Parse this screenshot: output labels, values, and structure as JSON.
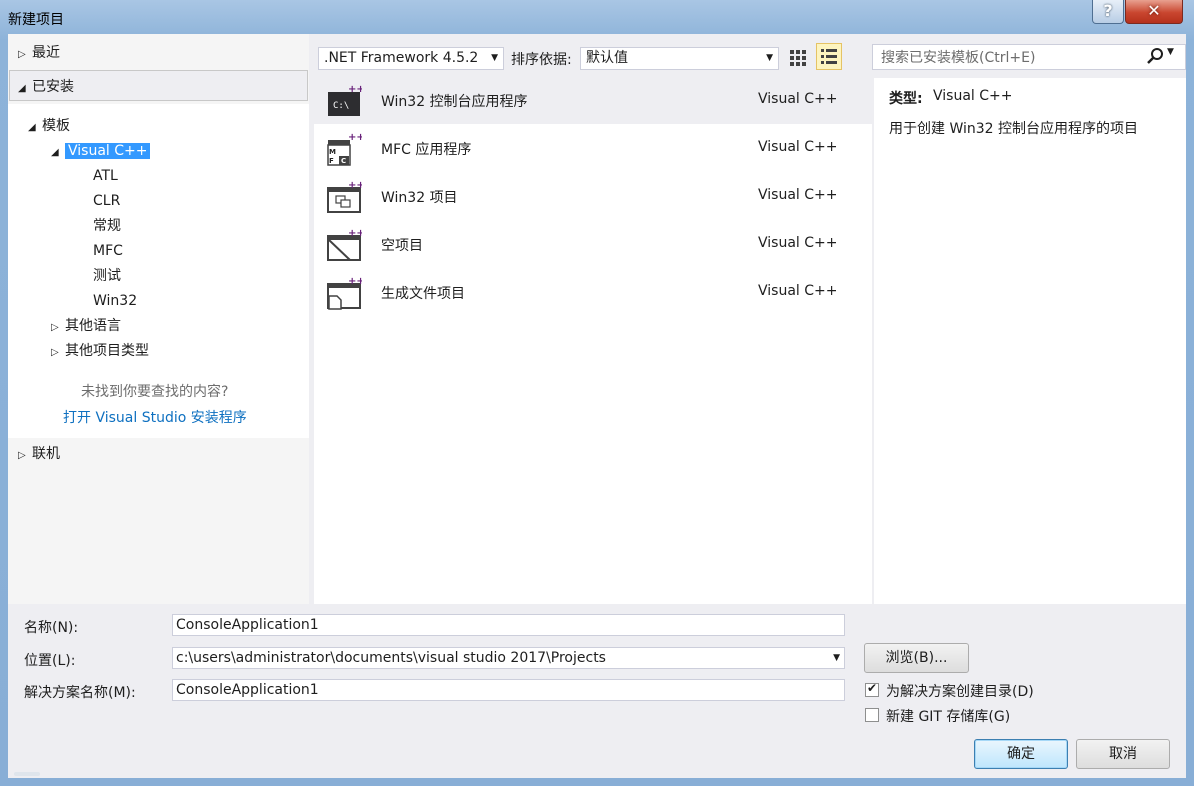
{
  "window": {
    "title": "新建项目",
    "help_glyph": "?",
    "close_glyph": "✕"
  },
  "left": {
    "recent": "最近",
    "installed": "已安装",
    "templates": "模板",
    "visual_cpp": "Visual C++",
    "children": [
      "ATL",
      "CLR",
      "常规",
      "MFC",
      "测试",
      "Win32"
    ],
    "other_languages": "其他语言",
    "other_project_types": "其他项目类型",
    "not_found": "未找到你要查找的内容?",
    "open_installer": "打开 Visual Studio 安装程序",
    "online": "联机"
  },
  "toolbar": {
    "framework": ".NET Framework 4.5.2",
    "sort_label": "排序依据:",
    "sort_value": "默认值"
  },
  "search": {
    "placeholder": "搜索已安装模板(Ctrl+E)"
  },
  "templates": [
    {
      "name": "Win32 控制台应用程序",
      "lang": "Visual C++",
      "icon": "console-app-icon"
    },
    {
      "name": "MFC 应用程序",
      "lang": "Visual C++",
      "icon": "mfc-app-icon"
    },
    {
      "name": "Win32 项目",
      "lang": "Visual C++",
      "icon": "win32-project-icon"
    },
    {
      "name": "空项目",
      "lang": "Visual C++",
      "icon": "empty-project-icon"
    },
    {
      "name": "生成文件项目",
      "lang": "Visual C++",
      "icon": "makefile-project-icon"
    }
  ],
  "details": {
    "type_label": "类型:",
    "type_value": "Visual C++",
    "description": "用于创建 Win32 控制台应用程序的项目"
  },
  "form": {
    "name_label": "名称(N):",
    "name_value": "ConsoleApplication1",
    "location_label": "位置(L):",
    "location_value": "c:\\users\\administrator\\documents\\visual studio 2017\\Projects",
    "solution_label": "解决方案名称(M):",
    "solution_value": "ConsoleApplication1",
    "browse": "浏览(B)...",
    "create_dir": "为解决方案创建目录(D)",
    "create_dir_checked": true,
    "new_git": "新建 GIT 存储库(G)",
    "new_git_checked": false,
    "ok": "确定",
    "cancel": "取消"
  },
  "colors": {
    "accent": "#3399ff",
    "link": "#0e70c0",
    "selected_bg": "#eeeef2"
  }
}
